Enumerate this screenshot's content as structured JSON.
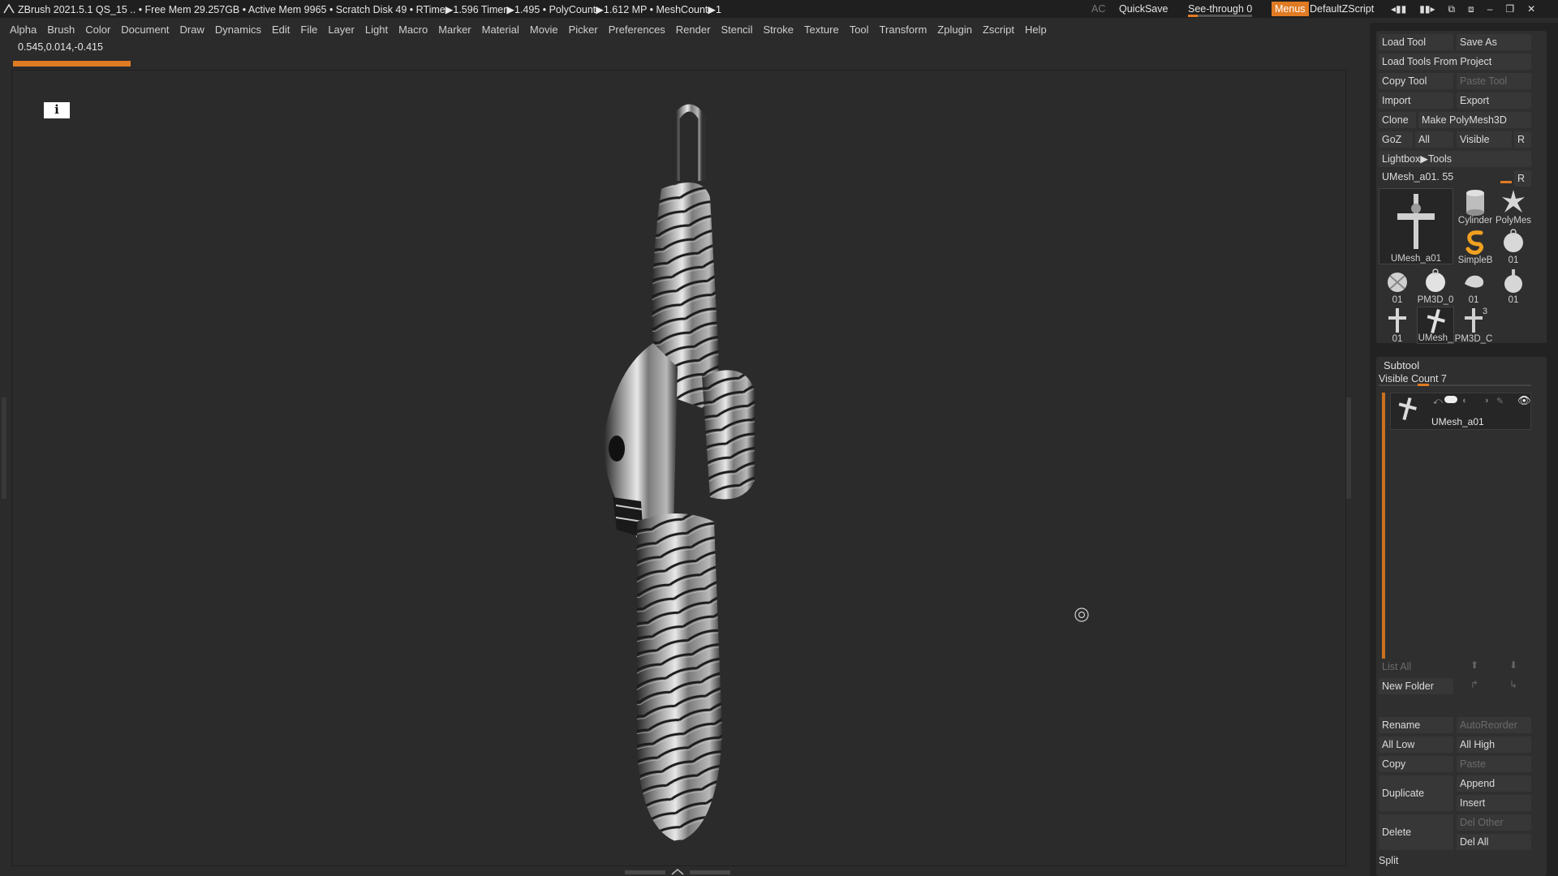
{
  "titlebar": {
    "status": "ZBrush 2021.5.1    QS_15    .. • Free Mem 29.257GB • Active Mem 9965 • Scratch Disk 49 •   RTime▶1.596 Timer▶1.495 • PolyCount▶1.612 MP  • MeshCount▶1",
    "ac": "AC",
    "quicksave": "QuickSave",
    "seethrough": "See-through   0",
    "seethrough_level": 0,
    "menus": "Menus",
    "script": "DefaultZScript"
  },
  "menubar": [
    "Alpha",
    "Brush",
    "Color",
    "Document",
    "Draw",
    "Dynamics",
    "Edit",
    "File",
    "Layer",
    "Light",
    "Macro",
    "Marker",
    "Material",
    "Movie",
    "Picker",
    "Preferences",
    "Render",
    "Stencil",
    "Stroke",
    "Texture",
    "Tool",
    "Transform",
    "Zplugin",
    "Zscript",
    "Help"
  ],
  "coords": "0.545,0.014,-0.415",
  "tool": {
    "load_tool": "Load Tool",
    "save_as": "Save As",
    "load_from_project": "Load Tools From Project",
    "copy_tool": "Copy Tool",
    "paste_tool": "Paste Tool",
    "import": "Import",
    "export": "Export",
    "clone": "Clone",
    "make_polymesh": "Make PolyMesh3D",
    "goz": "GoZ",
    "all": "All",
    "visible": "Visible",
    "r": "R",
    "lightbox": "Lightbox▶Tools",
    "current": "UMesh_a01. 55",
    "thumbs": [
      {
        "label": "UMesh_a01",
        "icon": "cross-pendant-icon"
      },
      {
        "label": "Cylinder",
        "icon": "cylinder-icon"
      },
      {
        "label": "PolyMes",
        "icon": "star-polymesh-icon"
      },
      {
        "label": "SimpleB",
        "icon": "simplebrush-icon"
      },
      {
        "label": "01",
        "icon": "skull-pendant-icon"
      },
      {
        "label": "01",
        "icon": "skull-pendant-icon"
      },
      {
        "label": "PM3D_0",
        "icon": "skull-pendant-icon"
      },
      {
        "label": "01",
        "icon": "hand-pendant-icon"
      },
      {
        "label": "01",
        "icon": "skull-pendant-icon"
      },
      {
        "label": "01",
        "icon": "cross-pendant-icon"
      },
      {
        "label": "UMesh_",
        "icon": "cross-pendant-icon"
      },
      {
        "label": "PM3D_C",
        "icon": "cross-pendant-icon"
      }
    ],
    "thumb_badge": "3"
  },
  "subtool": {
    "title": "Subtool",
    "visible_count": "Visible Count 7",
    "item_label": "UMesh_a01",
    "list_all": "List All",
    "new_folder": "New Folder",
    "rename": "Rename",
    "autoreorder": "AutoReorder",
    "all_low": "All Low",
    "all_high": "All High",
    "copy": "Copy",
    "paste": "Paste",
    "duplicate": "Duplicate",
    "append": "Append",
    "insert": "Insert",
    "delete": "Delete",
    "del_other": "Del Other",
    "del_all": "Del All",
    "split": "Split"
  },
  "colors": {
    "accent": "#e07b23",
    "panel": "#2f2f2f",
    "button": "#373737",
    "canvas": "#2b2b2b"
  }
}
